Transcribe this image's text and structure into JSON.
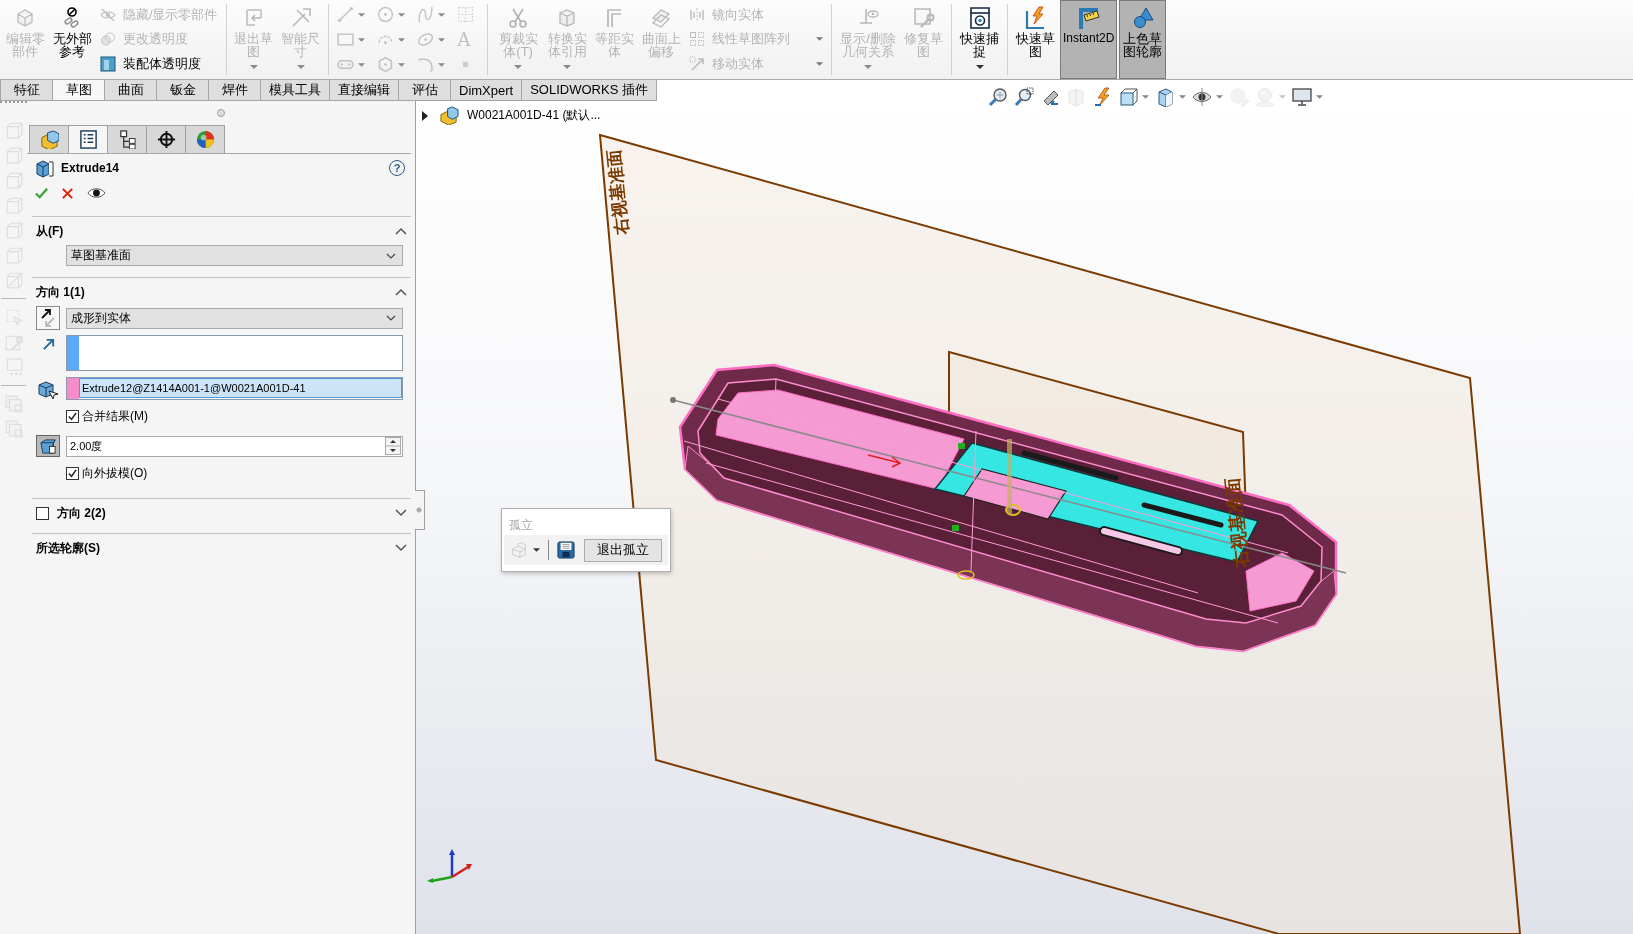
{
  "command_manager": {
    "groups": [
      {
        "items": [
          {
            "kind": "large",
            "label": "编辑零部件",
            "disabled": true,
            "dropdown": false,
            "pressed": false
          },
          {
            "kind": "large",
            "label": "无外部参考",
            "disabled": false,
            "dropdown": false,
            "pressed": false
          },
          {
            "kind": "column",
            "entries": [
              {
                "label": "隐藏/显示零部件",
                "disabled": true,
                "dropdown": false
              },
              {
                "label": "更改透明度",
                "disabled": true,
                "dropdown": false
              },
              {
                "label": "装配体透明度",
                "disabled": false,
                "dropdown": false
              }
            ]
          }
        ]
      },
      {
        "items": [
          {
            "kind": "large",
            "label": "退出草图",
            "disabled": true,
            "dropdown": true,
            "pressed": false
          },
          {
            "kind": "large",
            "label": "智能尺寸",
            "disabled": true,
            "dropdown": true,
            "pressed": false
          }
        ]
      },
      {
        "items": [
          {
            "kind": "grid",
            "tools": [
              {
                "disabled": true,
                "dropdown": true
              },
              {
                "disabled": true,
                "dropdown": true
              },
              {
                "disabled": true,
                "dropdown": true
              },
              {
                "disabled": true,
                "dropdown": false
              },
              {
                "disabled": true,
                "dropdown": true
              },
              {
                "disabled": true,
                "dropdown": true
              },
              {
                "disabled": true,
                "dropdown": true
              },
              {
                "disabled": true,
                "dropdown": false,
                "glyph": "A"
              },
              {
                "disabled": true,
                "dropdown": true
              },
              {
                "disabled": true,
                "dropdown": true
              },
              {
                "disabled": true,
                "dropdown": true
              },
              {
                "disabled": true,
                "dropdown": false
              }
            ]
          }
        ]
      },
      {
        "items": [
          {
            "kind": "large",
            "label": "剪裁实体(T)",
            "disabled": true,
            "dropdown": true,
            "pressed": false
          },
          {
            "kind": "large",
            "label": "转换实体引用",
            "disabled": true,
            "dropdown": true,
            "pressed": false
          },
          {
            "kind": "large",
            "label": "等距实体",
            "disabled": true,
            "dropdown": false,
            "pressed": false
          },
          {
            "kind": "large",
            "label": "曲面上偏移",
            "disabled": true,
            "dropdown": false,
            "pressed": false
          },
          {
            "kind": "column",
            "entries": [
              {
                "label": "镜向实体",
                "disabled": true,
                "dropdown": false
              },
              {
                "label": "线性草图阵列",
                "disabled": true,
                "dropdown": true
              },
              {
                "label": "移动实体",
                "disabled": true,
                "dropdown": true
              }
            ]
          }
        ]
      },
      {
        "items": [
          {
            "kind": "large",
            "label": "显示/删除几何关系",
            "disabled": true,
            "dropdown": true,
            "pressed": false
          },
          {
            "kind": "large",
            "label": "修复草图",
            "disabled": true,
            "dropdown": false,
            "pressed": false
          }
        ]
      },
      {
        "items": [
          {
            "kind": "large",
            "label": "快速捕捉",
            "disabled": false,
            "dropdown": true,
            "pressed": false
          }
        ]
      },
      {
        "items": [
          {
            "kind": "large",
            "label": "快速草图",
            "disabled": false,
            "dropdown": false,
            "pressed": false
          },
          {
            "kind": "large",
            "label": "Instant2D",
            "disabled": false,
            "dropdown": false,
            "pressed": true
          },
          {
            "kind": "large",
            "label": "上色草图轮廓",
            "disabled": false,
            "dropdown": false,
            "pressed": true
          }
        ]
      }
    ]
  },
  "tabs": [
    {
      "label": "特征",
      "selected": false
    },
    {
      "label": "草图",
      "selected": true
    },
    {
      "label": "曲面",
      "selected": false
    },
    {
      "label": "钣金",
      "selected": false
    },
    {
      "label": "焊件",
      "selected": false
    },
    {
      "label": "模具工具",
      "selected": false
    },
    {
      "label": "直接编辑",
      "selected": false
    },
    {
      "label": "评估",
      "selected": false
    },
    {
      "label": "DimXpert",
      "selected": false
    },
    {
      "label": "SOLIDWORKS 插件",
      "selected": false
    }
  ],
  "view_toolbar": [
    {
      "disabled": false,
      "dropdown": false
    },
    {
      "disabled": false,
      "dropdown": false
    },
    {
      "disabled": false,
      "dropdown": false
    },
    {
      "disabled": true,
      "dropdown": false
    },
    {
      "disabled": false,
      "dropdown": false
    },
    {
      "disabled": false,
      "dropdown": true
    },
    {
      "disabled": false,
      "dropdown": true
    },
    {
      "disabled": false,
      "dropdown": true
    },
    {
      "disabled": true,
      "dropdown": false
    },
    {
      "disabled": true,
      "dropdown": true
    },
    {
      "disabled": false,
      "dropdown": true
    }
  ],
  "left_toolbar": [
    {
      "tools": [
        {
          "disabled": true
        },
        {
          "disabled": true
        },
        {
          "disabled": true
        },
        {
          "disabled": true
        },
        {
          "disabled": true
        },
        {
          "disabled": true
        },
        {
          "disabled": true
        }
      ]
    },
    {
      "tools": [
        {
          "disabled": true
        },
        {
          "disabled": true
        },
        {
          "disabled": true
        }
      ]
    },
    {
      "tools": [
        {
          "disabled": true
        },
        {
          "disabled": true
        }
      ]
    }
  ],
  "property_manager": {
    "tabs": [
      {
        "selected": false
      },
      {
        "selected": true
      },
      {
        "selected": false
      },
      {
        "selected": false
      },
      {
        "selected": false
      }
    ],
    "title": "Extrude14",
    "help": "?",
    "sections": [
      {
        "title": "从(F)",
        "expanded": true,
        "rows": [
          {
            "kind": "dropdown",
            "value": "草图基准面"
          }
        ]
      },
      {
        "title": "方向 1(1)",
        "expanded": true,
        "rows": [
          {
            "kind": "end_condition",
            "value": "成形到实体"
          },
          {
            "kind": "direction_list",
            "color": "#5aaaf8"
          },
          {
            "kind": "body_list",
            "color": "#f78ccb",
            "items": [
              {
                "label": "Extrude12@Z1414A001-1@W0021A001D-41",
                "selected": true
              }
            ]
          },
          {
            "kind": "checkbox",
            "label": "合并结果(M)",
            "checked": true
          },
          {
            "kind": "draft",
            "on": true,
            "value": "2.00度"
          },
          {
            "kind": "checkbox",
            "label": "向外拔模(O)",
            "checked": true
          }
        ]
      },
      {
        "title": "方向 2(2)",
        "expanded": false,
        "checkbox": {
          "checked": false
        }
      },
      {
        "title": "所选轮廓(S)",
        "expanded": false
      }
    ]
  },
  "viewport": {
    "tree_flyout": {
      "expanded": false,
      "label": "W0021A001D-41 (默认..."
    },
    "planes": [
      {
        "label": "右视基准面"
      },
      {
        "label": "右视基准面"
      }
    ],
    "isolate_popup": {
      "title": "孤立",
      "button": "退出孤立"
    }
  }
}
